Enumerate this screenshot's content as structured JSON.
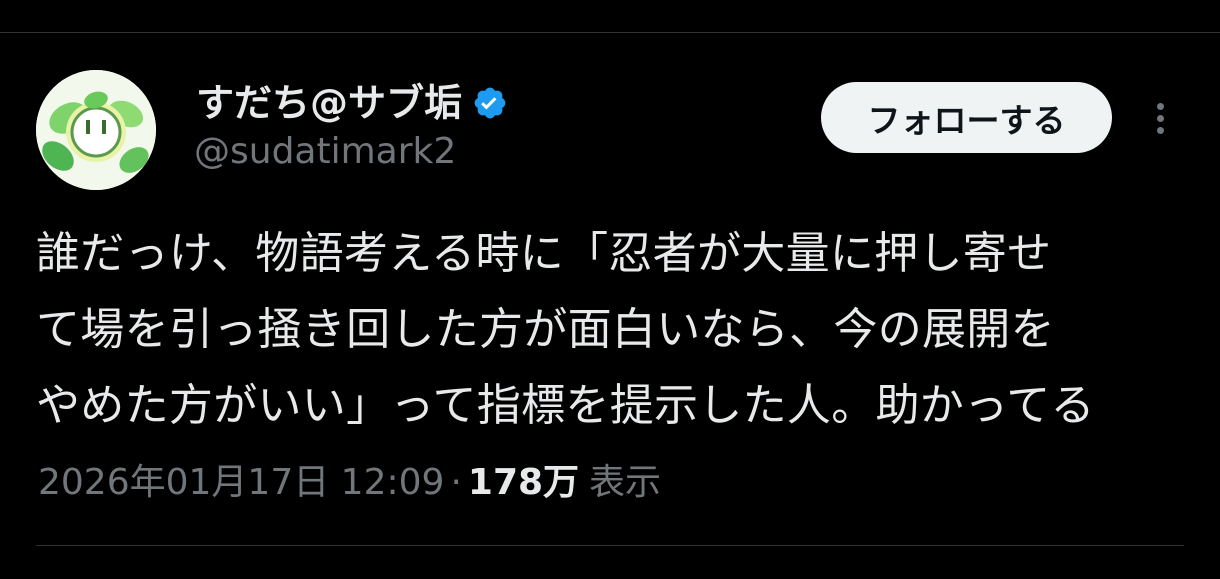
{
  "author": {
    "display_name": "すだち@サブ垢",
    "handle": "@sudatimark2",
    "verified_icon": "verified-badge-icon",
    "avatar_icon": "leaf-face-avatar"
  },
  "actions": {
    "follow_label": "フォローする",
    "more_icon": "more-vertical-icon"
  },
  "tweet": {
    "lines": [
      "誰だっけ、物語考える時に「忍者が大量に押し寄せ",
      "て場を引っ掻き回した方が面白いなら、今の展開を",
      "やめた方がいい」って指標を提示した人。助かってる"
    ]
  },
  "meta": {
    "timestamp": "2026年01月17日 12:09",
    "separator": "·",
    "views_count": "178万",
    "views_label": "表示"
  },
  "colors": {
    "background": "#000000",
    "text_primary": "#e7e9ea",
    "text_secondary": "#71767b",
    "verified": "#1d9bf0",
    "button_bg": "#eff3f4",
    "divider": "#2f3336"
  }
}
